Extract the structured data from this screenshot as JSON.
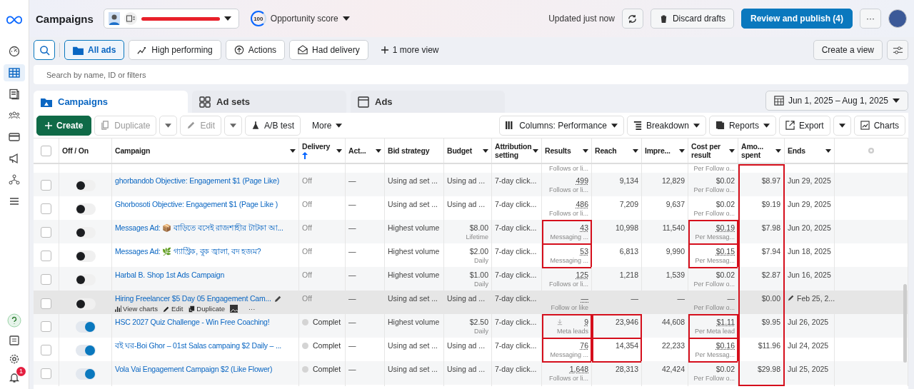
{
  "sidebar": {
    "items": [
      {
        "selected": false
      },
      {
        "selected": true
      },
      {
        "selected": false
      },
      {
        "selected": false
      },
      {
        "selected": false
      },
      {
        "selected": false
      },
      {
        "selected": false
      },
      {
        "selected": false
      }
    ],
    "notification_count": "1"
  },
  "header": {
    "title": "Campaigns",
    "opportunity_score": "100",
    "opportunity_label": "Opportunity score",
    "updated": "Updated just now",
    "discard": "Discard drafts",
    "publish": "Review and publish (4)",
    "more": "···"
  },
  "views": [
    {
      "label": "All ads",
      "selected": true
    },
    {
      "label": "High performing",
      "selected": false
    },
    {
      "label": "Actions",
      "selected": false
    },
    {
      "label": "Had delivery",
      "selected": false
    }
  ],
  "more_views": "1 more view",
  "create_view": "Create a view",
  "search": {
    "placeholder": "Search by name, ID or filters"
  },
  "level_tabs": [
    {
      "label": "Campaigns",
      "selected": true
    },
    {
      "label": "Ad sets",
      "selected": false
    },
    {
      "label": "Ads",
      "selected": false
    }
  ],
  "date_range": "Jun 1, 2025 – Aug 1, 2025",
  "toolbar": {
    "create": "Create",
    "duplicate": "Duplicate",
    "edit": "Edit",
    "ab_test": "A/B test",
    "more": "More",
    "columns": "Columns: Performance",
    "breakdown": "Breakdown",
    "reports": "Reports",
    "export": "Export",
    "charts": "Charts",
    "duplicate_disabled": true,
    "edit_disabled": true
  },
  "table": {
    "columns": [
      {
        "label": "Off / On",
        "caret": false
      },
      {
        "label": "Campaign",
        "caret": true
      },
      {
        "label": "Delivery",
        "caret": true,
        "sorted": true
      },
      {
        "label": "Act...",
        "caret": true
      },
      {
        "label": "Bid strategy",
        "caret": false
      },
      {
        "label": "Budget",
        "caret": true
      },
      {
        "label": "Attribution setting",
        "caret": true
      },
      {
        "label": "Results",
        "caret": true
      },
      {
        "label": "Reach",
        "caret": true
      },
      {
        "label": "Impre...",
        "caret": true
      },
      {
        "label": "Cost per result",
        "caret": true
      },
      {
        "label": "Amo... spent",
        "caret": true
      },
      {
        "label": "Ends",
        "caret": true
      }
    ],
    "partial_row": {
      "results_note": "Follows or li...",
      "cost_note": "Per Follow o..."
    },
    "rows": [
      {
        "name": "ghorbandob Objective: Engagement $1 (Page Like)",
        "on": false,
        "delivery": "Off",
        "complete": false,
        "act": "—",
        "bid": "Using ad set ...",
        "budget": "Using ad ...",
        "attribution": "7-day click...",
        "results": "499",
        "results_icon": false,
        "results_note": "Follows or li...",
        "reach": "9,134",
        "impressions": "12,829",
        "cost": "$0.02",
        "cost_note": "Per Follow o...",
        "spent": "$8.97",
        "ends": "Jun 29, 2025",
        "hovered": false,
        "hl_results": false,
        "hl_reach": false,
        "hl_cost": false
      },
      {
        "name": "Ghorbosoti Objective: Engagement $1 (Page Like )",
        "on": false,
        "delivery": "Off",
        "complete": false,
        "act": "—",
        "bid": "Using ad set ...",
        "budget": "Using ad ...",
        "attribution": "7-day click...",
        "results": "486",
        "results_icon": false,
        "results_note": "Follows or li...",
        "reach": "7,209",
        "impressions": "9,637",
        "cost": "$0.02",
        "cost_note": "Per Follow o...",
        "spent": "$9.19",
        "ends": "Jun 29, 2025",
        "hovered": false,
        "hl_results": false,
        "hl_reach": false,
        "hl_cost": false
      },
      {
        "name": "Messages Ad: 📦 বাড়িতে বসেই রাজশাহীর টাটকা আ...",
        "on": false,
        "delivery": "Off",
        "complete": false,
        "act": "—",
        "bid": "Highest volume",
        "budget": "$8.00",
        "budget_note": "Lifetime",
        "attribution": "7-day click...",
        "results": "43",
        "results_icon": false,
        "results_note": "Messaging ...",
        "reach": "10,998",
        "impressions": "11,540",
        "cost": "$0.19",
        "cost_note": "Per Messag...",
        "spent": "$7.98",
        "ends": "Jun 20, 2025",
        "hovered": false,
        "hl_results": true,
        "hl_reach": false,
        "hl_cost": true
      },
      {
        "name": "Messages Ad: 🌿 গ্যাস্ট্রিক, বুক জ্বালা, বদ হজম?",
        "on": false,
        "delivery": "Off",
        "complete": false,
        "act": "—",
        "bid": "Highest volume",
        "budget": "$2.00",
        "budget_note": "Daily",
        "attribution": "7-day click...",
        "results": "53",
        "results_icon": false,
        "results_note": "Messaging ...",
        "reach": "6,813",
        "impressions": "9,990",
        "cost": "$0.15",
        "cost_note": "Per Messag...",
        "spent": "$7.94",
        "ends": "Jun 18, 2025",
        "hovered": false,
        "hl_results": true,
        "hl_reach": false,
        "hl_cost": true
      },
      {
        "name": "Harbal B. Shop 1st Ads Campaign",
        "on": false,
        "delivery": "Off",
        "complete": false,
        "act": "—",
        "bid": "Highest volume",
        "budget": "$1.00",
        "budget_note": "Daily",
        "attribution": "7-day click...",
        "results": "125",
        "results_icon": false,
        "results_note": "Follows or li...",
        "reach": "1,218",
        "impressions": "1,539",
        "cost": "$0.02",
        "cost_note": "Per Follow o...",
        "spent": "$2.87",
        "ends": "Jun 16, 2025",
        "hovered": false,
        "hl_results": false,
        "hl_reach": false,
        "hl_cost": false
      },
      {
        "name": "Hiring Freelancer $5 Day 05 Engagement Cam...",
        "on": false,
        "delivery": "Off",
        "complete": false,
        "act": "—",
        "bid": "Using ad set ...",
        "budget": "Using ad ...",
        "attribution": "7-day click...",
        "results": "—",
        "results_icon": false,
        "results_note": "Follow or like",
        "reach": "—",
        "impressions": "—",
        "cost": "—",
        "cost_note": "Per Follow o...",
        "spent": "$0.00",
        "ends": "Feb 25, 2...",
        "hovered": true,
        "hl_results": false,
        "hl_reach": false,
        "hl_cost": false,
        "actions": {
          "view_charts": "View charts",
          "edit": "Edit",
          "duplicate": "Duplicate",
          "more": "···"
        }
      },
      {
        "name": "HSC 2027 Quiz Challenge - Win Free Coaching!",
        "on": true,
        "delivery": "Complet",
        "complete": true,
        "act": "—",
        "bid": "Highest volume",
        "budget": "$2.50",
        "budget_note": "Daily",
        "attribution": "7-day click...",
        "results": "9",
        "results_icon": true,
        "results_note": "Meta leads",
        "reach": "23,946",
        "impressions": "44,608",
        "cost": "$1.11",
        "cost_note": "Per Meta lead",
        "spent": "$9.95",
        "ends": "Jul 26, 2025",
        "hovered": false,
        "hl_results": true,
        "hl_reach": true,
        "hl_cost": true
      },
      {
        "name": "বই ঘর-Boi Ghor – 01st Salas campaing $2 Daily – ...",
        "on": true,
        "delivery": "Complet",
        "complete": true,
        "act": "—",
        "bid": "Using ad set ...",
        "budget": "Using ad ...",
        "attribution": "7-day click...",
        "results": "76",
        "results_icon": false,
        "results_note": "Messaging ...",
        "reach": "14,354",
        "impressions": "22,233",
        "cost": "$0.16",
        "cost_note": "Per Messag...",
        "spent": "$11.96",
        "ends": "Jul 24, 2025",
        "hovered": false,
        "hl_results": true,
        "hl_reach": true,
        "hl_cost": true
      },
      {
        "name": "Vola Vai Engagement Campaign $2 (Like Flower)",
        "on": true,
        "delivery": "Complet",
        "complete": true,
        "act": "—",
        "bid": "Using ad set ...",
        "budget": "Using ad ...",
        "attribution": "7-day click...",
        "results": "1,648",
        "results_icon": false,
        "results_note": "Follows or li...",
        "reach": "28,313",
        "impressions": "42,424",
        "cost": "$0.02",
        "cost_note": "Per Follow o...",
        "spent": "$29.98",
        "ends": "Jul 25, 2025",
        "hovered": false,
        "hl_results": false,
        "hl_reach": false,
        "hl_cost": false
      }
    ],
    "spent_highlighted": true,
    "select_all_checked": false
  }
}
